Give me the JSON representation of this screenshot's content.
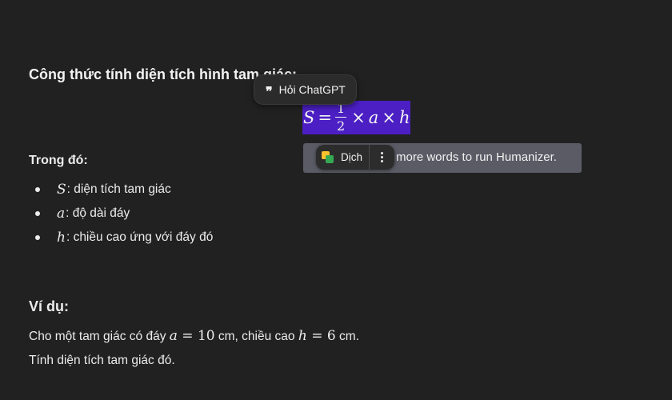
{
  "content": {
    "heading": "Công thức tính diện tích hình tam giác:",
    "formula": {
      "lhs": "S",
      "eq": "=",
      "num": "1",
      "den": "2",
      "times": "×",
      "a": "a",
      "h": "h"
    },
    "where_title": "Trong đó:",
    "definitions": [
      {
        "var": "S",
        "text": ": diện tích tam giác"
      },
      {
        "var": "a",
        "text": ": độ dài đáy"
      },
      {
        "var": "h",
        "text": ": chiều cao ứng với đáy đó"
      }
    ],
    "example_title": "Ví dụ:",
    "example": {
      "p1": "Cho một tam giác có đáy ",
      "a_var": "a",
      "eq": " = ",
      "a_val": "10",
      "unit1": " cm, chiều cao ",
      "h_var": "h",
      "h_val": "6",
      "unit2": " cm.",
      "line2": "Tính diện tích tam giác đó."
    }
  },
  "ask_popup": {
    "icon": "quote-icon",
    "label": "Hỏi ChatGPT"
  },
  "humanizer": {
    "text": "more words to run Humanizer."
  },
  "translate_toolbar": {
    "label": "Dịch",
    "icon": "google-translate-icon",
    "more_icon": "more-vertical-icon"
  },
  "colors": {
    "background": "#212121",
    "selection": "#4b1fc4",
    "humanizer_bar": "#5b5b66",
    "popup": "#2b2b2b"
  }
}
